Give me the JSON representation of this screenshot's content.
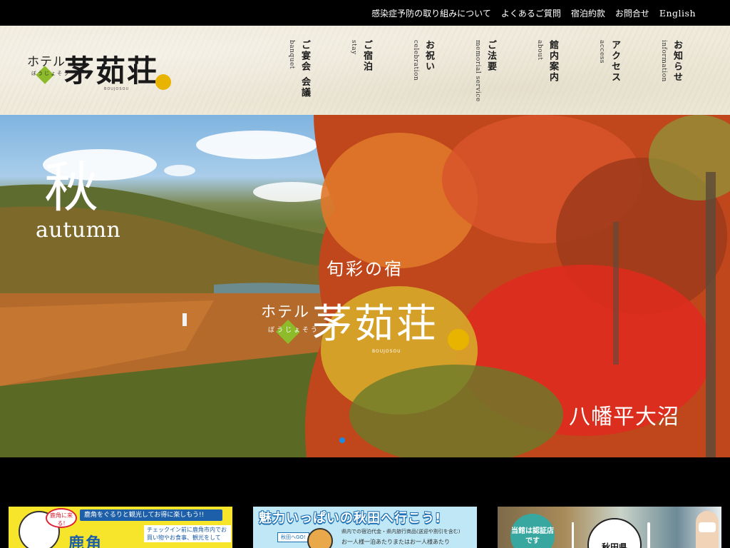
{
  "topbar": {
    "links": [
      "感染症予防の取り組みについて",
      "よくあるご質問",
      "宿泊約款",
      "お問合せ"
    ],
    "english": "English"
  },
  "logo": {
    "hotel": "ホテル",
    "name": "茅茹荘",
    "furigana": "ぼうじょそう",
    "roman": "BOUJOSOU"
  },
  "gnav": [
    {
      "jp": "ご宴会 会議",
      "en": "banquet"
    },
    {
      "jp": "ご宿泊",
      "en": "stay"
    },
    {
      "jp": "お祝い",
      "en": "celebration"
    },
    {
      "jp": "ご法要",
      "en": "memorial service"
    },
    {
      "jp": "館内案内",
      "en": "about"
    },
    {
      "jp": "アクセス",
      "en": "access"
    },
    {
      "jp": "お知らせ",
      "en": "information"
    }
  ],
  "hero": {
    "season_kanji": "秋",
    "season_en": "autumn",
    "catch": "旬彩の宿",
    "hotel": "ホテル",
    "name": "茅茹荘",
    "furigana": "ぼうじょそう",
    "roman": "BOUJOSOU",
    "place": "八幡平大沼"
  },
  "banners": {
    "kazuno": {
      "badge": "鹿角に来る!",
      "head": "鹿角をぐるりと観光してお得に楽しもう!!",
      "big": "鹿角",
      "small": "チェックイン前に鹿角市内でお買い物やお食事、観光をして"
    },
    "akita": {
      "head": "魅力いっぱいの秋田へ行こう!",
      "tag": "秋田へGO!",
      "sub": "県内での宿泊代金・県内旅行商品(送迎や割引を含む)",
      "sub2": "お一人様一泊あたりまたはお一人様あたり"
    },
    "certified": {
      "seal": "当館は認証店です",
      "plate": "秋田県"
    }
  },
  "colors": {
    "accent_green": "#8dbb2a",
    "accent_yellow": "#e8b400",
    "slider_active": "#1e88e5"
  }
}
